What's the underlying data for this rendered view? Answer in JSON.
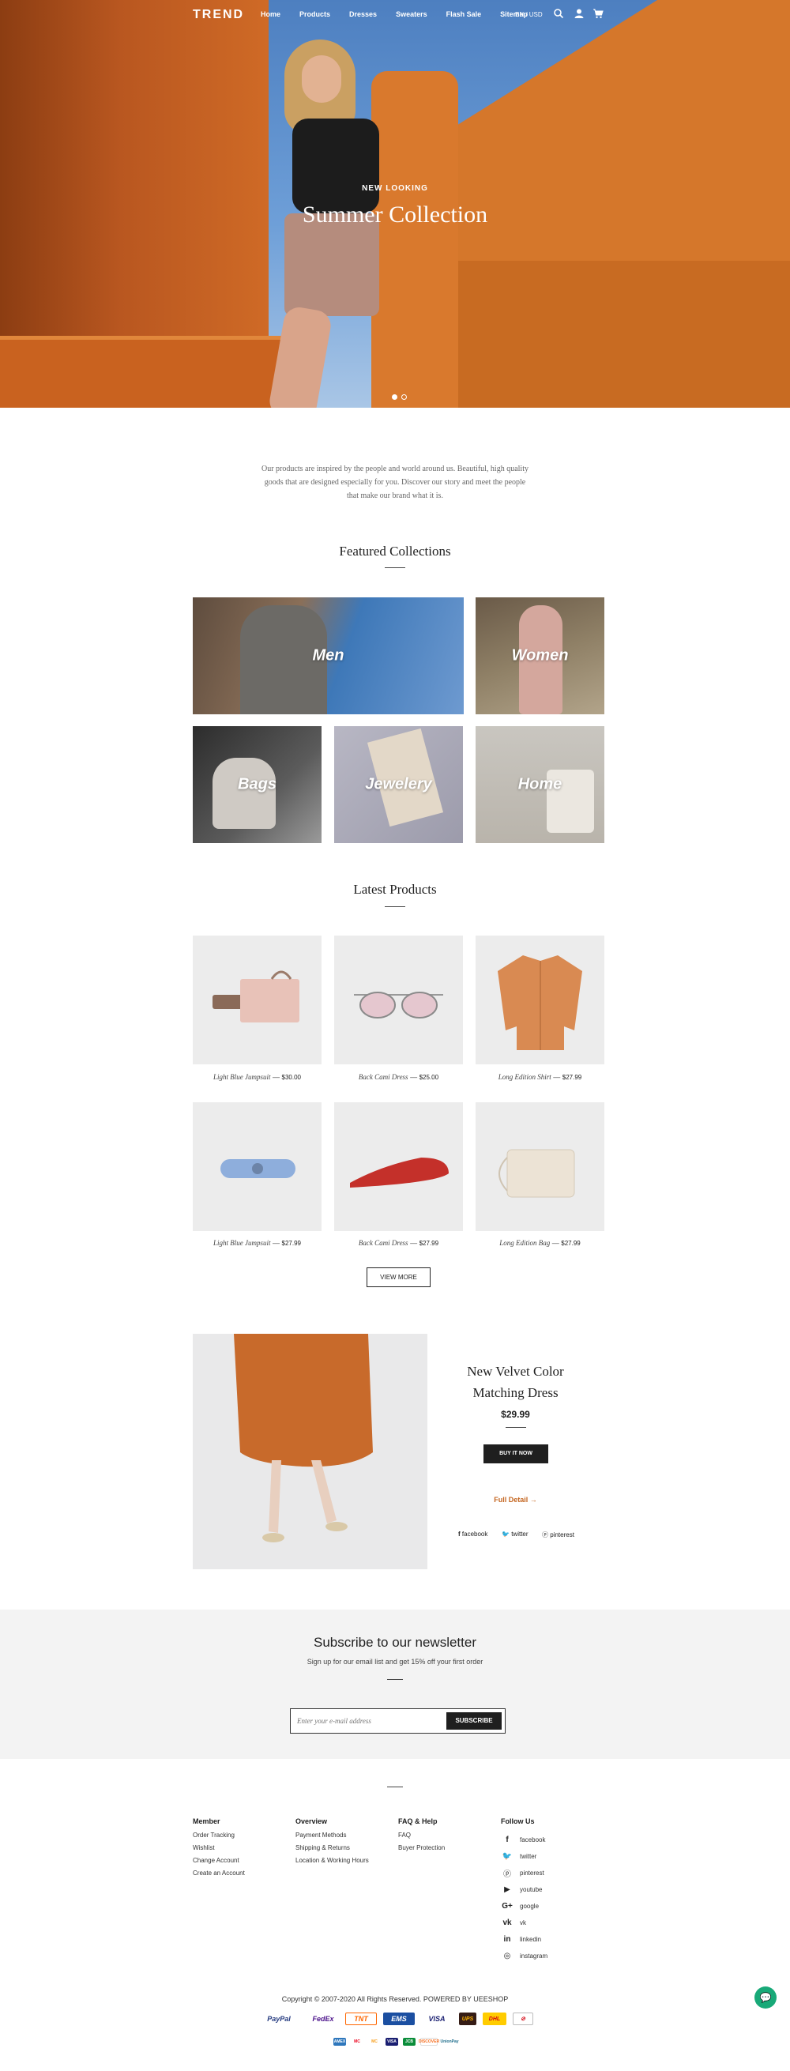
{
  "header": {
    "logo": "TREND",
    "menu": [
      "Home",
      "Products",
      "Dresses",
      "Sweaters",
      "Flash Sale",
      "Sitemap"
    ],
    "lang": "EN  /  USD",
    "icons": [
      "search-icon",
      "user-icon",
      "cart-icon"
    ]
  },
  "hero": {
    "eyebrow": "NEW LOOKING",
    "title": "Summer Collection",
    "slides": 2,
    "active_slide": 1
  },
  "intro": {
    "text": "Our products are inspired by the people and world around us. Beautiful, high quality goods that are designed especially for you. Discover our story and meet the people that make our brand what it is."
  },
  "featured": {
    "title": "Featured Collections",
    "items": [
      "Men",
      "Women",
      "Bags",
      "Jewelery",
      "Home"
    ]
  },
  "latest": {
    "title": "Latest Products",
    "products": [
      {
        "name": "Light Blue Jumpsuit",
        "price": "$30.00"
      },
      {
        "name": "Back Cami Dress",
        "price": "$25.00"
      },
      {
        "name": "Long Edition Shirt",
        "price": "$27.99"
      },
      {
        "name": "Light Blue Jumpsuit",
        "price": "$27.99"
      },
      {
        "name": "Back Cami Dress",
        "price": "$27.99"
      },
      {
        "name": "Long Edition Bag",
        "price": "$27.99"
      }
    ],
    "separator": "—",
    "view_more": "VIEW MORE"
  },
  "feature": {
    "title_line1": "New Velvet Color",
    "title_line2": "Matching Dress",
    "price": "$29.99",
    "buy": "BUY IT NOW",
    "full_detail": "Full Detail →",
    "share": [
      "facebook",
      "twitter",
      "pinterest"
    ]
  },
  "newsletter": {
    "title": "Subscribe to our newsletter",
    "subtitle": "Sign up for our email list and get 15% off your first order",
    "placeholder": "Enter your e-mail address",
    "button": "SUBSCRIBE"
  },
  "footer": {
    "member": {
      "title": "Member",
      "links": [
        "Order Tracking",
        "Wishlist",
        "Change Account",
        "Create an Account"
      ]
    },
    "overview": {
      "title": "Overview",
      "links": [
        "Payment Methods",
        "Shipping & Returns",
        "Location & Working Hours"
      ]
    },
    "faq": {
      "title": "FAQ & Help",
      "links": [
        "FAQ",
        "Buyer Protection"
      ]
    },
    "follow": {
      "title": "Follow Us",
      "links": [
        "facebook",
        "twitter",
        "pinterest",
        "youtube",
        "google",
        "vk",
        "linkedin",
        "instagram"
      ]
    },
    "copyright": "Copyright © 2007-2020 All Rights Reserved. POWERED BY UEESHOP",
    "payments": [
      "PayPal",
      "FedEx",
      "TNT",
      "EMS",
      "VISA",
      "UPS",
      "DHL"
    ],
    "payments_small": [
      "AMEX",
      "MC",
      "MC",
      "VISA",
      "JCB",
      "DISCOVER",
      "UnionPay"
    ]
  },
  "colors": {
    "accent": "#c4651f",
    "dark": "#1f1f1f",
    "chat": "#18a978"
  }
}
